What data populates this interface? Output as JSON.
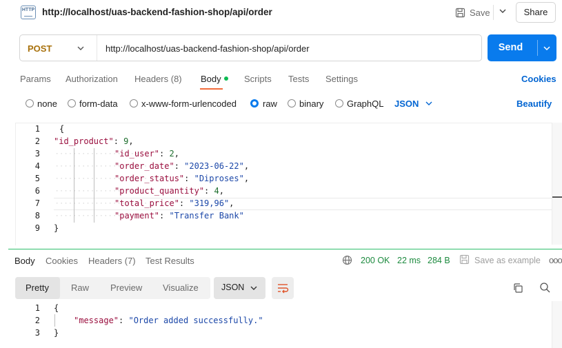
{
  "header": {
    "request_title": "http://localhost/uas-backend-fashion-shop/api/order",
    "save_label": "Save",
    "share_label": "Share",
    "http_icon_text": "HTTP"
  },
  "request": {
    "method": "POST",
    "url": "http://localhost/uas-backend-fashion-shop/api/order",
    "send_label": "Send",
    "method_color": "#a8710c",
    "send_color": "#097bed"
  },
  "request_tabs": {
    "params": "Params",
    "authorization": "Authorization",
    "headers": "Headers (8)",
    "body": "Body",
    "scripts": "Scripts",
    "tests": "Tests",
    "settings": "Settings",
    "cookies": "Cookies"
  },
  "body_types": {
    "none": "none",
    "form_data": "form-data",
    "urlencoded": "x-www-form-urlencoded",
    "raw": "raw",
    "binary": "binary",
    "graphql": "GraphQL",
    "selected": "raw",
    "format": "JSON",
    "beautify": "Beautify"
  },
  "request_body": {
    "line_numbers": [
      "1",
      "2",
      "3",
      "4",
      "5",
      "6",
      "7",
      "8",
      "9"
    ],
    "open_brace": "{",
    "close_brace": "}",
    "fields": [
      {
        "key": "\"id_product\"",
        "value": "9",
        "type": "number"
      },
      {
        "key": "\"id_user\"",
        "value": "2",
        "type": "number"
      },
      {
        "key": "\"order_date\"",
        "value": "\"2023-06-22\"",
        "type": "string"
      },
      {
        "key": "\"order_status\"",
        "value": "\"Diproses\"",
        "type": "string"
      },
      {
        "key": "\"product_quantity\"",
        "value": "4",
        "type": "number"
      },
      {
        "key": "\"total_price\"",
        "value": "\"319,96\"",
        "type": "string"
      },
      {
        "key": "\"payment\"",
        "value": "\"Transfer Bank\"",
        "type": "string"
      }
    ]
  },
  "response_tabs": {
    "body": "Body",
    "cookies": "Cookies",
    "headers": "Headers (7)",
    "test_results": "Test Results",
    "status": "200 OK",
    "time": "22 ms",
    "size": "284 B",
    "save_example": "Save as example",
    "more": "ooo"
  },
  "response_view": {
    "pretty": "Pretty",
    "raw": "Raw",
    "preview": "Preview",
    "visualize": "Visualize",
    "format": "JSON"
  },
  "response_body": {
    "line_numbers": [
      "1",
      "2",
      "3"
    ],
    "open_brace": "{",
    "close_brace": "}",
    "key": "\"message\"",
    "value": "\"Order added successfully.\""
  }
}
